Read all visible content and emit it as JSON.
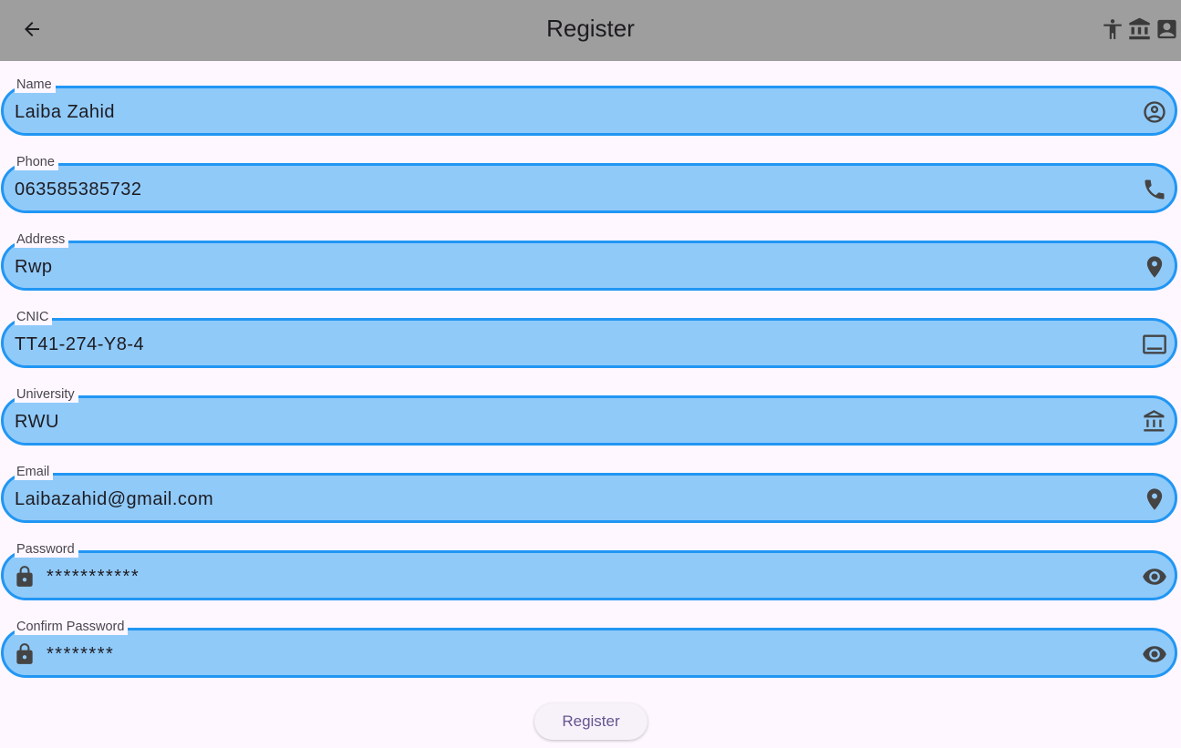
{
  "appbar": {
    "title": "Register",
    "background": "#9e9e9e",
    "actions": [
      "accessibility-icon",
      "bank-icon",
      "contact-card-icon"
    ]
  },
  "form": {
    "fields": [
      {
        "label": "Name",
        "value": "Laiba Zahid",
        "icon": "account-circle-icon"
      },
      {
        "label": "Phone",
        "value": "063585385732",
        "icon": "phone-icon"
      },
      {
        "label": "Address",
        "value": "Rwp",
        "icon": "location-pin-icon"
      },
      {
        "label": "CNIC",
        "value": "TT41-274-Y8-4",
        "icon": "card-icon"
      },
      {
        "label": "University",
        "value": "RWU",
        "icon": "bank-icon"
      },
      {
        "label": "Email",
        "value": "Laibazahid@gmail.com",
        "icon": "location-pin-icon"
      },
      {
        "label": "Password",
        "value": "***********",
        "prefix_icon": "lock-icon",
        "icon": "eye-icon"
      },
      {
        "label": "Confirm Password",
        "value": "********",
        "prefix_icon": "lock-icon",
        "icon": "eye-icon"
      }
    ],
    "field_fill": "#90caf9",
    "field_border": "#2196f3",
    "submit_label": "Register"
  }
}
